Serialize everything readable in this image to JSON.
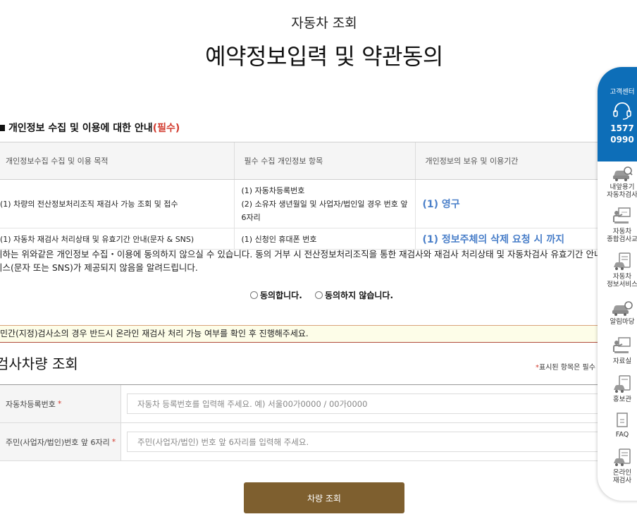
{
  "header": {
    "subtitle": "자동차 조회",
    "title": "예약정보입력 및 약관동의"
  },
  "privacy": {
    "title": "개인정보 수집 및 이용에 대한 안내",
    "required": "(필수)",
    "columns": [
      "개인정보수집 수집 및 이용 목적",
      "필수 수집 개인정보 항목",
      "개인정보의 보유 및 이용기간"
    ],
    "rows": [
      {
        "purpose": "(1) 차량의 전산정보처리조직 재검사 가능 조회 및 접수",
        "items": [
          "(1) 자동차등록번호",
          "(2) 소유자 생년월일 및 사업자/법인일 경우 번호 앞",
          "6자리"
        ],
        "period": "(1) 영구"
      },
      {
        "purpose": "(1) 자동차 재검사 처리상태 및 유효기간 안내(문자 & SNS)",
        "items": [
          "(1) 신청인 휴대폰 번호"
        ],
        "period": "(1) 정보주체의 삭제 요청 시 까지"
      }
    ],
    "notice_line1": "귀하는 위와같은 개인정보 수집・이용에 동의하지 않으실 수 있습니다. 동의 거부 시 전산정보처리조직을 통한 재검사와 재검사 처리상태 및 자동차검사 유효기간 안내",
    "notice_line2": "비스(문자 또는 SNS)가 제공되지 않음을 알려드립니다.",
    "agree_label": "동의합니다.",
    "disagree_label": "동의하지 않습니다."
  },
  "warning": "민간(지정)검사소의 경우 반드시 온라인 재검사 처리 가능 여부를 확인 후 진행해주세요.",
  "search": {
    "title": "검사차량 조회",
    "required_note_mark": "*",
    "required_note": "표시된 항목은 필수",
    "fields": [
      {
        "label": "자동차등록번호",
        "mark": "*",
        "placeholder": "자동차 등록번호를 입력해 주세요. 예) 서울00가0000 / 00가0000"
      },
      {
        "label": "주민(사업자/법인)번호 앞 6자리",
        "mark": "*",
        "placeholder": "주민(사업자/법인) 번호 앞 6자리를 입력해 주세요."
      }
    ],
    "submit_label": "차량 조회"
  },
  "side_panel": {
    "title": "고객센터",
    "phone_line1": "1577",
    "phone_line2": "0990",
    "accent": "#0d6eb8",
    "items": [
      {
        "icon": "car-search-icon",
        "line1": "내앞용기",
        "line2": "자동차검사"
      },
      {
        "icon": "presentation-icon",
        "line1": "자동차",
        "line2": "종합검사교"
      },
      {
        "icon": "info-car-icon",
        "line1": "자동차",
        "line2": "정보서비스"
      },
      {
        "icon": "car-bell-icon",
        "line1": "알림마당",
        "line2": ""
      },
      {
        "icon": "archive-icon",
        "line1": "자료실",
        "line2": ""
      },
      {
        "icon": "pr-icon",
        "line1": "홍보관",
        "line2": ""
      },
      {
        "icon": "faq-icon",
        "line1": "FAQ",
        "line2": ""
      },
      {
        "icon": "online-recheck-icon",
        "line1": "온라인",
        "line2": "재검사"
      }
    ]
  },
  "colors": {
    "required_red": "#d23c2f",
    "period_blue": "#4a7fc9",
    "button_brown": "#7e5f2f",
    "warning_bg": "#fdfde8"
  }
}
